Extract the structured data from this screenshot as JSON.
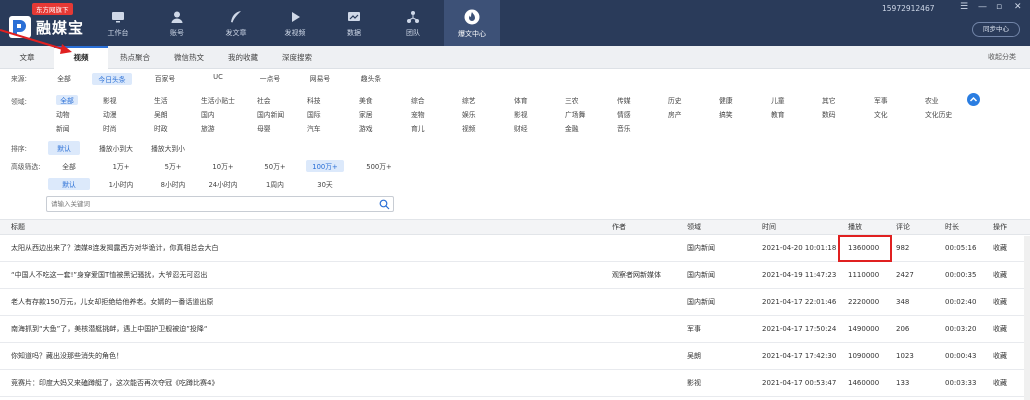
{
  "app": {
    "badge": "东方网旗下",
    "name": "融媒宝"
  },
  "nav": [
    {
      "label": "工作台",
      "icon": "monitor-icon"
    },
    {
      "label": "账号",
      "icon": "user-icon"
    },
    {
      "label": "发文章",
      "icon": "feather-icon"
    },
    {
      "label": "发视频",
      "icon": "video-icon"
    },
    {
      "label": "数据",
      "icon": "chart-icon"
    },
    {
      "label": "团队",
      "icon": "team-icon"
    },
    {
      "label": "爆文中心",
      "icon": "fire-icon",
      "active": true
    }
  ],
  "user": {
    "phone": "15972912467",
    "window_buttons": [
      "☰",
      "—",
      "▫",
      "✕"
    ],
    "sync": "同步中心"
  },
  "tabs": [
    {
      "label": "文章"
    },
    {
      "label": "视频",
      "active": true
    },
    {
      "label": "热点聚合"
    },
    {
      "label": "微信热文"
    },
    {
      "label": "我的收藏"
    },
    {
      "label": "深度搜索"
    }
  ],
  "collapse_label": "收起分类",
  "filters": {
    "source": {
      "label": "来源:",
      "options": [
        "全部",
        "今日头条",
        "百家号",
        "UC",
        "一点号",
        "网易号",
        "趣头条"
      ],
      "selected": 1
    },
    "domain": {
      "label": "领域:",
      "rows": [
        [
          "全部",
          "影视",
          "生活",
          "生活小贴士",
          "社会",
          "科技",
          "美食",
          "综合",
          "综艺",
          "体育",
          "三农",
          "传媒",
          "历史",
          "健康",
          "儿童",
          "其它",
          "军事",
          "农业"
        ],
        [
          "动物",
          "动漫",
          "吴朗",
          "国内",
          "国内新闻",
          "国际",
          "家居",
          "宠物",
          "娱乐",
          "影视",
          "广场舞",
          "情感",
          "房产",
          "搞笑",
          "教育",
          "数码",
          "文化",
          "文化历史"
        ],
        [
          "新闻",
          "时尚",
          "时政",
          "旅游",
          "母婴",
          "汽车",
          "游戏",
          "育儿",
          "视频",
          "财经",
          "金融",
          "音乐"
        ]
      ],
      "selected": "全部"
    },
    "sort": {
      "label": "排序:",
      "options": [
        "默认",
        "播放小到大",
        "播放大到小"
      ],
      "selected": 0
    },
    "advanced": {
      "label": "高级筛选:",
      "plays": [
        "全部",
        "1万+",
        "5万+",
        "10万+",
        "50万+",
        "100万+",
        "500万+"
      ],
      "plays_selected": 5,
      "times": [
        "默认",
        "1小时内",
        "8小时内",
        "24小时内",
        "1周内",
        "30天"
      ],
      "times_selected": 0
    }
  },
  "search": {
    "placeholder": "请输入关键词",
    "icon": "search-icon"
  },
  "table": {
    "headers": [
      "标题",
      "作者",
      "领域",
      "时间",
      "播放",
      "评论",
      "时长",
      "操作"
    ],
    "rows": [
      {
        "title": "太阳从西边出来了？澳媒8连发揭露西方对华诡计，你真相总会大白",
        "author": "",
        "domain": "国内新闻",
        "time": "2021-04-20 10:01:18",
        "plays": "1360000",
        "comments": "982",
        "duration": "00:05:16",
        "action": "收藏"
      },
      {
        "title": "“中国人不吃这一套!”身穿爱国T恤被黑记骚扰，大爷忍无可忍出",
        "author": "观察者网新媒体",
        "domain": "国内新闻",
        "time": "2021-04-19 11:47:23",
        "plays": "1110000",
        "comments": "2427",
        "duration": "00:00:35",
        "action": "收藏"
      },
      {
        "title": "老人有存款150万元，儿女却拒绝给他养老。女婿的一番话道出原",
        "author": "",
        "domain": "国内新闻",
        "time": "2021-04-17 22:01:46",
        "plays": "2220000",
        "comments": "348",
        "duration": "00:02:40",
        "action": "收藏"
      },
      {
        "title": "南海抓到“大鱼”了，美核潜艇挑衅，遇上中国护卫舰被迫”投降“",
        "author": "",
        "domain": "军事",
        "time": "2021-04-17 17:50:24",
        "plays": "1490000",
        "comments": "206",
        "duration": "00:03:20",
        "action": "收藏"
      },
      {
        "title": "你知道吗？藏出没那些消失的角色！",
        "author": "",
        "domain": "吴朗",
        "time": "2021-04-17 17:42:30",
        "plays": "1090000",
        "comments": "1023",
        "duration": "00:00:43",
        "action": "收藏"
      },
      {
        "title": "竞赛片：印度大妈又来磕蹲艇了，这次能否再次夺冠《吃蹲比赛4》",
        "author": "",
        "domain": "影视",
        "time": "2021-04-17 00:53:47",
        "plays": "1460000",
        "comments": "133",
        "duration": "00:03:33",
        "action": "收藏"
      }
    ]
  },
  "colors": {
    "topbar": "#2a3b5a",
    "accent": "#2a6fd6",
    "highlight": "#e02020",
    "selected_bg": "#dce9fb"
  }
}
